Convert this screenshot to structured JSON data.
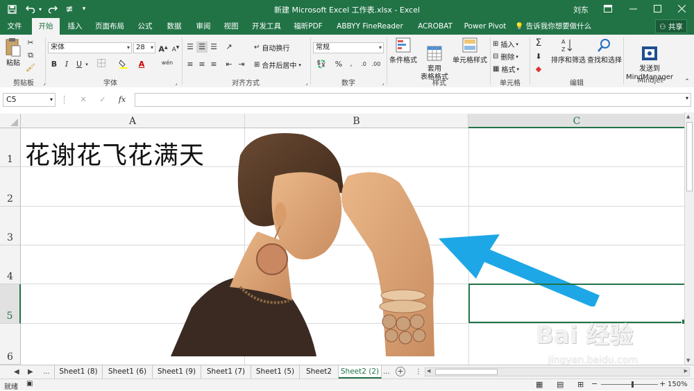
{
  "window": {
    "title": "新建 Microsoft Excel 工作表.xlsx  -  Excel",
    "user": "刘东",
    "controls": [
      "ribbon-display",
      "minimize",
      "maximize",
      "close"
    ]
  },
  "quick_access": [
    "save-icon",
    "undo-icon",
    "redo-icon",
    "touch-mode-icon",
    "customize-icon"
  ],
  "tabs": [
    {
      "label": "文件"
    },
    {
      "label": "开始",
      "active": true
    },
    {
      "label": "插入"
    },
    {
      "label": "页面布局"
    },
    {
      "label": "公式"
    },
    {
      "label": "数据"
    },
    {
      "label": "审阅"
    },
    {
      "label": "视图"
    },
    {
      "label": "开发工具"
    },
    {
      "label": "福昕PDF"
    },
    {
      "label": "ABBYY FineReader 12"
    },
    {
      "label": "ACROBAT"
    },
    {
      "label": "Power Pivot"
    }
  ],
  "tell_me": "告诉我你想要做什么",
  "share": "共享",
  "ribbon": {
    "clipboard": {
      "paste": "粘贴",
      "label": "剪贴板"
    },
    "font": {
      "name": "宋体",
      "size": "28",
      "bold": "B",
      "italic": "I",
      "underline": "U",
      "grow": "A",
      "shrink": "A",
      "label": "字体",
      "wen": "wén"
    },
    "alignment": {
      "wrap": "自动换行",
      "merge": "合并后居中",
      "label": "对齐方式"
    },
    "number": {
      "format": "常规",
      "label": "数字",
      "percent": "%"
    },
    "styles": {
      "conditional": "条件格式",
      "table": "套用\n表格格式",
      "cell": "单元格样式",
      "label": "样式"
    },
    "cells": {
      "insert": "插入",
      "delete": "删除",
      "format": "格式",
      "label": "单元格"
    },
    "editing": {
      "sort": "排序和筛选",
      "find": "查找和选择",
      "label": "编辑"
    },
    "mindjet": {
      "send": "发送到\nMindManager",
      "label": "Mindjet"
    }
  },
  "formula_bar": {
    "name_box": "C5",
    "fx": "fx",
    "content": ""
  },
  "grid": {
    "columns": [
      "A",
      "B",
      "C"
    ],
    "selected_column": "C",
    "rows": [
      "1",
      "2",
      "3",
      "4",
      "5",
      "6"
    ],
    "selected_row": "5",
    "cells": {
      "A1": "花谢花飞花满天"
    }
  },
  "sheets": {
    "nav_more": "...",
    "tabs": [
      "Sheet1 (8)",
      "Sheet1 (6)",
      "Sheet1 (9)",
      "Sheet1 (7)",
      "Sheet1 (5)",
      "Sheet2",
      "Sheet2 (2)"
    ],
    "active": "Sheet2 (2)",
    "more": "..."
  },
  "status": {
    "text": "就绪",
    "zoom": "150%"
  },
  "watermark": {
    "logo": "Bai 经验",
    "sub": "jingyan.baidu.com"
  },
  "colors": {
    "accent": "#217346",
    "arrow": "#1ea7e6"
  }
}
